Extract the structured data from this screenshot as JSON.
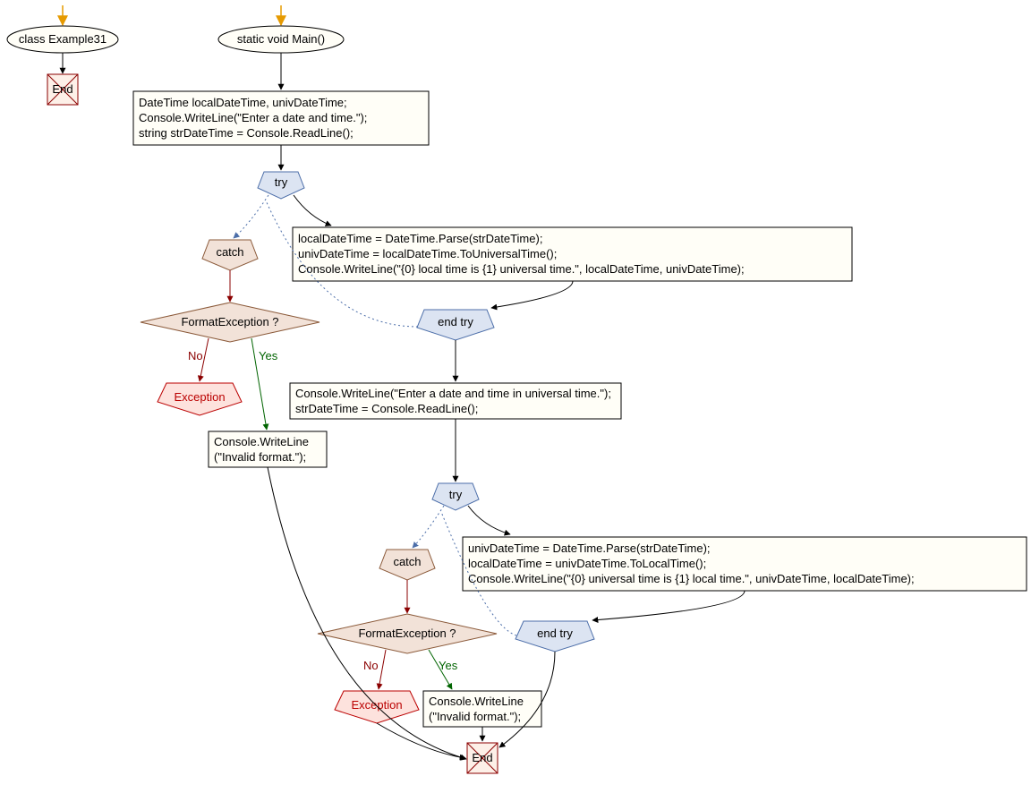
{
  "nodes": {
    "class_oval": "class Example31",
    "main_oval": "static void Main()",
    "block1_l1": "DateTime localDateTime, univDateTime;",
    "block1_l2": "Console.WriteLine(\"Enter a date and time.\");",
    "block1_l3": "string strDateTime = Console.ReadLine();",
    "try1": "try",
    "catch1": "catch",
    "fmtq1": "FormatException ?",
    "exc1": "Exception",
    "invalid1_l1": "Console.WriteLine",
    "invalid1_l2": "(\"Invalid format.\");",
    "body1_l1": "localDateTime = DateTime.Parse(strDateTime);",
    "body1_l2": "univDateTime = localDateTime.ToUniversalTime();",
    "body1_l3": "Console.WriteLine(\"{0} local time is {1} universal time.\", localDateTime, univDateTime);",
    "endtry1": "end try",
    "block2_l1": "Console.WriteLine(\"Enter a date and time in universal time.\");",
    "block2_l2": "strDateTime = Console.ReadLine();",
    "try2": "try",
    "catch2": "catch",
    "fmtq2": "FormatException ?",
    "exc2": "Exception",
    "invalid2_l1": "Console.WriteLine",
    "invalid2_l2": "(\"Invalid format.\");",
    "body2_l1": "univDateTime = DateTime.Parse(strDateTime);",
    "body2_l2": "localDateTime = univDateTime.ToLocalTime();",
    "body2_l3": "Console.WriteLine(\"{0} universal time is {1} local time.\", univDateTime, localDateTime);",
    "endtry2": "end try",
    "end1": "End",
    "end2": "End"
  },
  "labels": {
    "yes": "Yes",
    "no": "No"
  }
}
